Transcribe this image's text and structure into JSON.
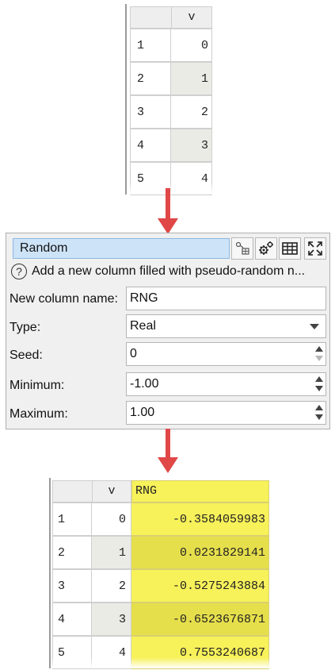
{
  "input_table": {
    "column_header": "v",
    "rows": [
      {
        "row": "1",
        "v": "0"
      },
      {
        "row": "2",
        "v": "1"
      },
      {
        "row": "3",
        "v": "2"
      },
      {
        "row": "4",
        "v": "3"
      },
      {
        "row": "5",
        "v": "4"
      }
    ]
  },
  "dialog": {
    "title": "Random",
    "toolbar_icons": [
      "connections-icon",
      "settings-gears-icon",
      "table-icon",
      "expand-icon"
    ],
    "help_text": "Add a new column filled with pseudo-random n...",
    "fields": {
      "new_column_name": {
        "label": "New column name:",
        "value": "RNG"
      },
      "type": {
        "label": "Type:",
        "value": "Real"
      },
      "seed": {
        "label": "Seed:",
        "value": "0"
      },
      "minimum": {
        "label": "Minimum:",
        "value": "-1.00"
      },
      "maximum": {
        "label": "Maximum:",
        "value": "1.00"
      }
    }
  },
  "output_table": {
    "headers": [
      "v",
      "RNG"
    ],
    "rows": [
      {
        "row": "1",
        "v": "0",
        "rng": "-0.3584059983"
      },
      {
        "row": "2",
        "v": "1",
        "rng": "0.0231829141"
      },
      {
        "row": "3",
        "v": "2",
        "rng": "-0.5275243884"
      },
      {
        "row": "4",
        "v": "3",
        "rng": "-0.6523676871"
      },
      {
        "row": "5",
        "v": "4",
        "rng": "0.7553240687"
      }
    ]
  },
  "colors": {
    "arrow": "#e04848",
    "highlight_yellow": "#f7f15a",
    "title_blue": "#cde3f7"
  }
}
